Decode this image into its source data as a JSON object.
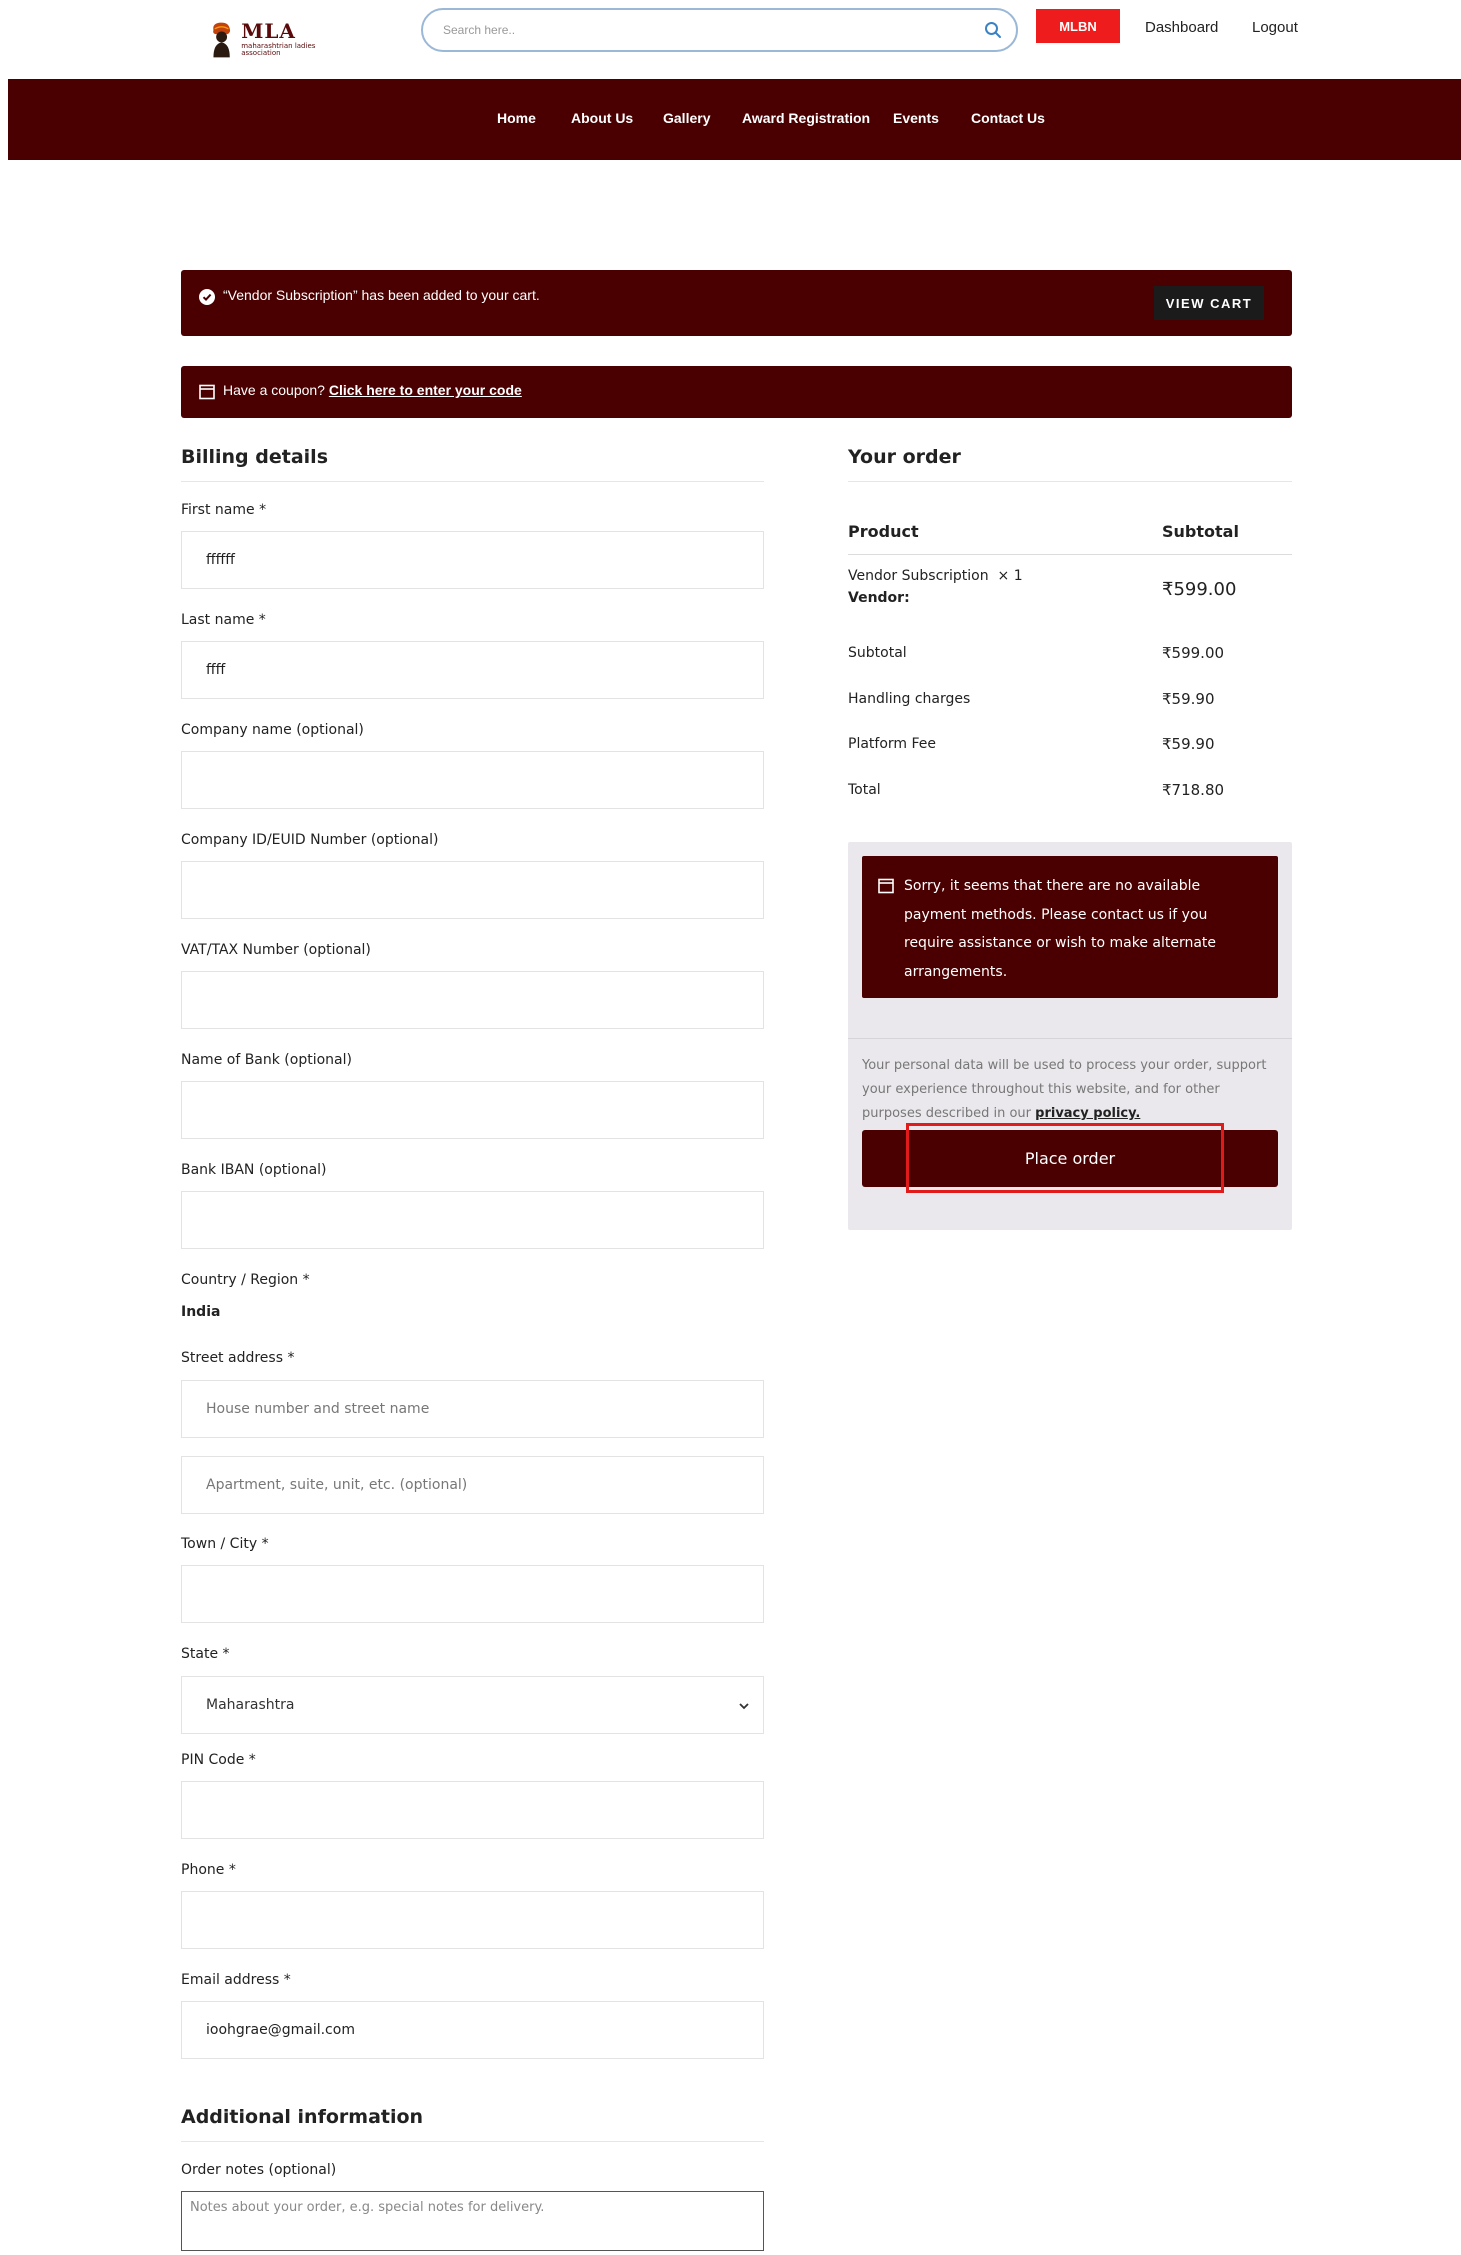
{
  "header": {
    "logo_text": "MLA",
    "logo_subtext": "maharashtrian ladies association",
    "search_placeholder": "Search here..",
    "mlbn_label": "MLBN",
    "dashboard_label": "Dashboard",
    "logout_label": "Logout",
    "accent_color": "#ee1c1c"
  },
  "nav": {
    "items": [
      "Home",
      "About Us",
      "Gallery",
      "Award Registration",
      "Events",
      "Contact Us"
    ],
    "background": "#4a0000"
  },
  "notices": {
    "cart_message": "“Vendor Subscription” has been added to your cart.",
    "view_cart_label": "VIEW CART",
    "coupon_prefix": "Have a coupon?",
    "coupon_link": "Click here to enter your code"
  },
  "billing": {
    "title": "Billing details",
    "first_name": {
      "label": "First name *",
      "value": "ffffff"
    },
    "last_name": {
      "label": "Last name *",
      "value": "ffff"
    },
    "company_name": {
      "label": "Company name (optional)",
      "value": ""
    },
    "company_id": {
      "label": "Company ID/EUID Number (optional)",
      "value": ""
    },
    "vat": {
      "label": "VAT/TAX Number (optional)",
      "value": ""
    },
    "bank_name": {
      "label": "Name of Bank (optional)",
      "value": ""
    },
    "bank_iban": {
      "label": "Bank IBAN (optional)",
      "value": ""
    },
    "country": {
      "label": "Country / Region *",
      "value": "India"
    },
    "street": {
      "label": "Street address *",
      "placeholder1": "House number and street name",
      "placeholder2": "Apartment, suite, unit, etc. (optional)"
    },
    "city": {
      "label": "Town / City *",
      "value": ""
    },
    "state": {
      "label": "State *",
      "value": "Maharashtra"
    },
    "pin": {
      "label": "PIN Code *",
      "value": ""
    },
    "phone": {
      "label": "Phone *",
      "value": ""
    },
    "email": {
      "label": "Email address *",
      "value": "ioohgrae@gmail.com"
    }
  },
  "additional": {
    "title": "Additional information",
    "notes_label": "Order notes (optional)",
    "notes_placeholder": "Notes about your order, e.g. special notes for delivery."
  },
  "order": {
    "title": "Your order",
    "col_product": "Product",
    "col_subtotal": "Subtotal",
    "item_name": "Vendor Subscription",
    "item_qty": "× 1",
    "item_vendor": "Vendor:",
    "item_price": "₹599.00",
    "rows": [
      {
        "label": "Subtotal",
        "value": "₹599.00"
      },
      {
        "label": "Handling charges",
        "value": "₹59.90"
      },
      {
        "label": "Platform Fee",
        "value": "₹59.90"
      },
      {
        "label": "Total",
        "value": "₹718.80"
      }
    ],
    "payment_notice": "Sorry, it seems that there are no available payment methods. Please contact us if you require assistance or wish to make alternate arrangements.",
    "privacy_text": "Your personal data will be used to process your order, support your experience throughout this website, and for other purposes described in our",
    "privacy_link": "privacy policy.",
    "place_order_label": "Place order",
    "highlight_color": "#e11a1a"
  }
}
